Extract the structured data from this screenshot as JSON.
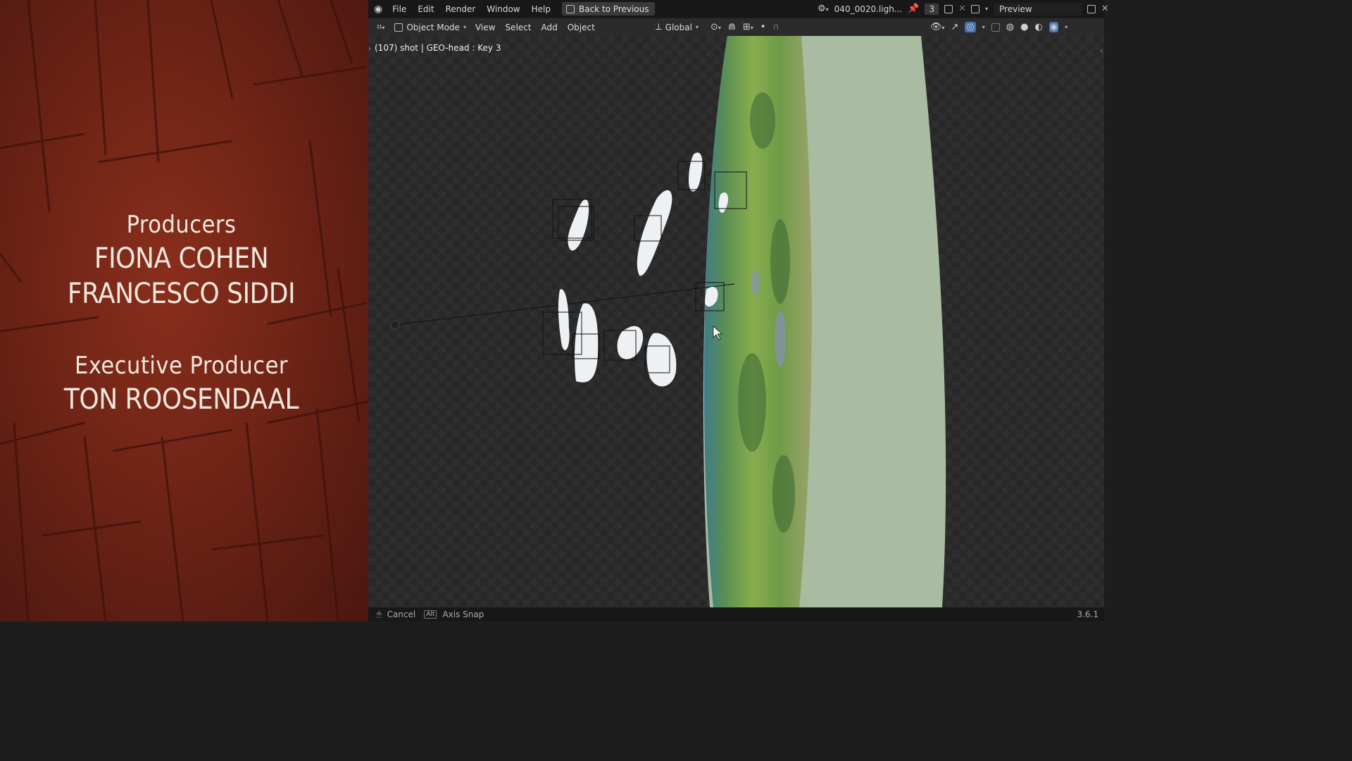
{
  "credits": {
    "block1": {
      "role": "Producers",
      "names": [
        "FIONA COHEN",
        "FRANCESCO SIDDI"
      ]
    },
    "block2": {
      "role": "Executive Producer",
      "names": [
        "TON ROOSENDAAL"
      ]
    }
  },
  "topbar": {
    "menus": [
      "File",
      "Edit",
      "Render",
      "Window",
      "Help"
    ],
    "back_button": "Back to Previous",
    "scene_name": "040_0020.ligh...",
    "scene_count": "3",
    "view_layer": "Preview"
  },
  "header": {
    "mode": "Object Mode",
    "menus": [
      "View",
      "Select",
      "Add",
      "Object"
    ],
    "transform_orientation": "Global"
  },
  "viewport": {
    "info": "(107) shot | GEO-head : Key 3"
  },
  "statusbar": {
    "cancel": "Cancel",
    "alt_key": "Alt",
    "axis_snap": "Axis Snap",
    "version": "3.6.1"
  },
  "colors": {
    "accent": "#4772b3",
    "panel_bg": "#2b2b2b",
    "topbar_bg": "#181818",
    "wood": "#6e2416"
  },
  "icons": [
    "blender-logo-icon",
    "back-icon",
    "scene-icon",
    "pin-icon",
    "add-scene-icon",
    "close-icon",
    "view-layer-icon",
    "editor-type-icon",
    "object-mode-icon",
    "orientation-icon",
    "pivot-icon",
    "snap-icon",
    "proportional-icon",
    "visibility-icon",
    "gizmo-icon",
    "overlay-icon",
    "xray-icon",
    "wireframe-shading-icon",
    "solid-shading-icon",
    "material-shading-icon",
    "rendered-shading-icon",
    "mouse-icon"
  ]
}
